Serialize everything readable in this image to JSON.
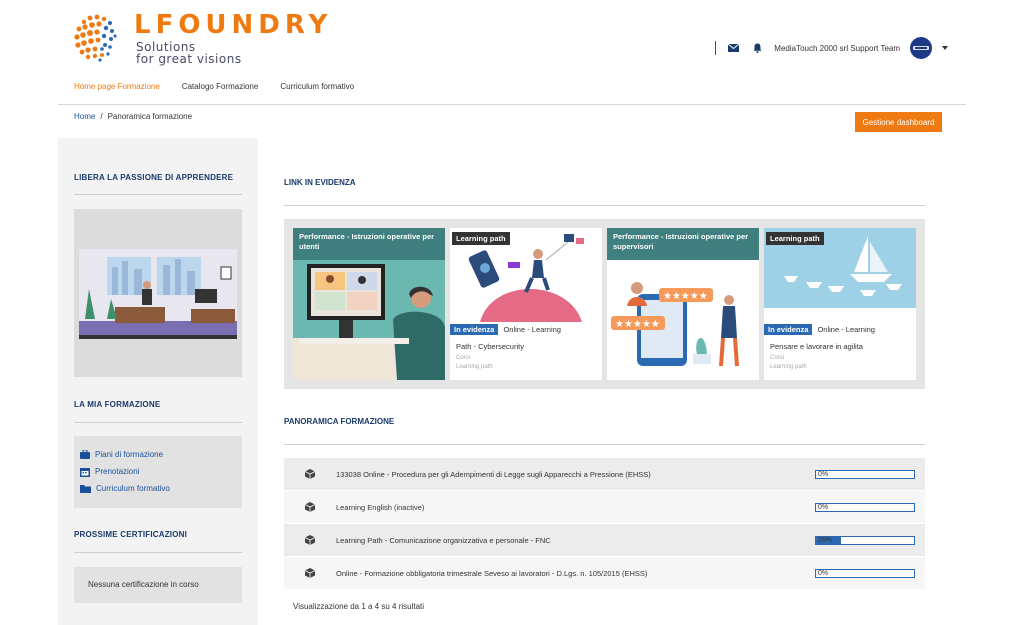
{
  "brand": {
    "name": "LFOUNDRY",
    "tagline_line1": "Solutions",
    "tagline_line2": "for great visions"
  },
  "topbar": {
    "user_name": "MediaTouch 2000 srl Support Team",
    "mail_icon": "envelope-icon",
    "bell_icon": "bell-icon"
  },
  "nav": {
    "items": [
      {
        "label": "Home page Formazione",
        "active": true
      },
      {
        "label": "Catalogo Formazione",
        "active": false
      },
      {
        "label": "Curriculum formativo",
        "active": false
      }
    ]
  },
  "breadcrumb": {
    "home": "Home",
    "separator": "/",
    "current": "Panoramica formazione"
  },
  "dashboard_button": "Gestione dashboard",
  "sidebar": {
    "section1_title": "LIBERA LA PASSIONE DI APPRENDERE",
    "section2_title": "LA MIA FORMAZIONE",
    "links": [
      {
        "label": "Piani di formazione",
        "icon": "briefcase-icon"
      },
      {
        "label": "Prenotazioni",
        "icon": "calendar-icon"
      },
      {
        "label": "Curriculum formativo",
        "icon": "folder-icon"
      }
    ],
    "section3_title": "PROSSIME CERTIFICAZIONI",
    "no_cert": "Nessuna certificazione in corso"
  },
  "featured": {
    "title": "LINK IN EVIDENZA",
    "cards": [
      {
        "title": "Performance - Istruzioni operative per utenti"
      },
      {
        "badge": "Learning path",
        "evidence": "In evidenza",
        "type": "Online - Learning",
        "name": "Path - Cybersecurity",
        "sub1": "Corsi",
        "sub2": "Learning path"
      },
      {
        "title": "Performance - Istruzioni operative per supervisori"
      },
      {
        "badge": "Learning path",
        "evidence": "In evidenza",
        "type": "Online - Learning",
        "name": "Pensare e lavorare in agilita",
        "sub1": "Corsi",
        "sub2": "Learning path"
      }
    ]
  },
  "overview": {
    "title": "PANORAMICA FORMAZIONE",
    "rows": [
      {
        "name": "133038 Online - Procedura per gli Adempimenti di Legge sugli Apparecchi a Pressione (EHSS)",
        "progress": 0,
        "progress_label": "0%"
      },
      {
        "name": "Learning English (inactive)",
        "progress": 0,
        "progress_label": "0%"
      },
      {
        "name": "Learning Path - Comunicazione organizzativa e personale - FNC",
        "progress": 26,
        "progress_label": "26%"
      },
      {
        "name": "Online - Formazione obbligatoria trimestrale Seveso ai lavoratori - D.Lgs. n. 105/2015 (EHSS)",
        "progress": 0,
        "progress_label": "0%"
      }
    ],
    "results": "Visualizzazione da 1 a 4 su 4 risultati"
  },
  "colors": {
    "accent": "#f07a12",
    "primary": "#2b6ab3",
    "title": "#1a3a6b"
  }
}
